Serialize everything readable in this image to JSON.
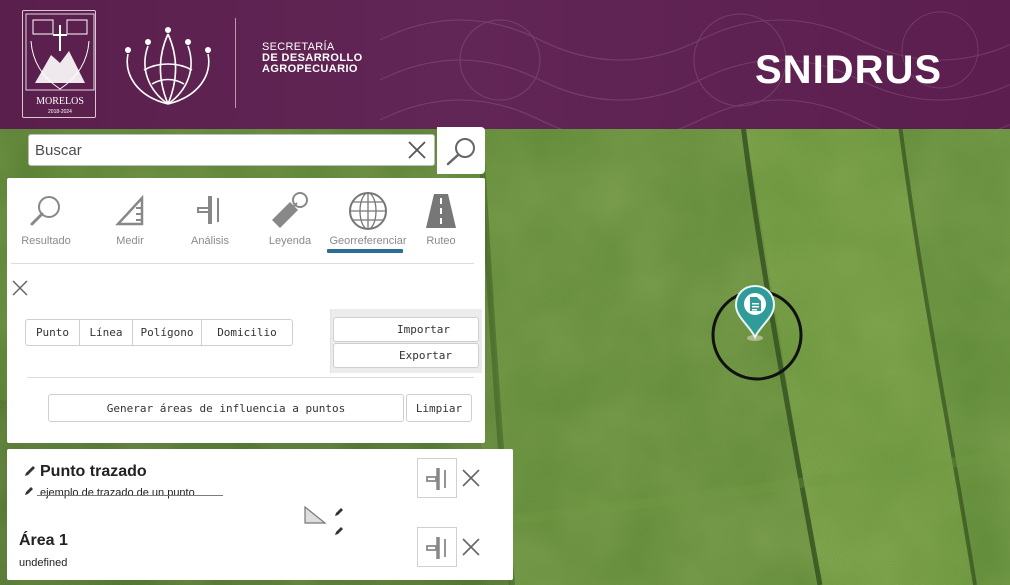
{
  "header": {
    "crest_label": "MORELOS",
    "crest_year": "2018-2024",
    "department_line1": "SECRETARÍA",
    "department_line2": "DE DESARROLLO",
    "department_line3": "AGROPECUARIO",
    "brand": "SNIDRUS"
  },
  "search": {
    "placeholder": "Buscar",
    "value": ""
  },
  "tools": {
    "tabs": [
      {
        "label": "Resultado",
        "icon": "magnifier-icon"
      },
      {
        "label": "Medir",
        "icon": "ruler-triangle-icon"
      },
      {
        "label": "Análisis",
        "icon": "analysis-tool-icon"
      },
      {
        "label": "Leyenda",
        "icon": "tag-icon"
      },
      {
        "label": "Georreferenciar",
        "icon": "globe-icon"
      },
      {
        "label": "Ruteo",
        "icon": "road-icon"
      }
    ],
    "active_tab": "Georreferenciar",
    "active_color": "#2a6e95",
    "draw_modes": [
      "Punto",
      "Línea",
      "Polígono",
      "Domicilio"
    ],
    "import_label": "Importar",
    "export_label": "Exportar",
    "buffer_label": "Generar áreas de influencia a puntos",
    "clear_label": "Limpiar"
  },
  "results": [
    {
      "title": "Punto trazado",
      "subtitle": "ejemplo de trazado de un punto"
    },
    {
      "title": "Área 1",
      "subtitle": "undefined"
    }
  ],
  "colors": {
    "header": "#5e2252",
    "marker": "#2f9c9a",
    "field": "#4f7a2e"
  }
}
